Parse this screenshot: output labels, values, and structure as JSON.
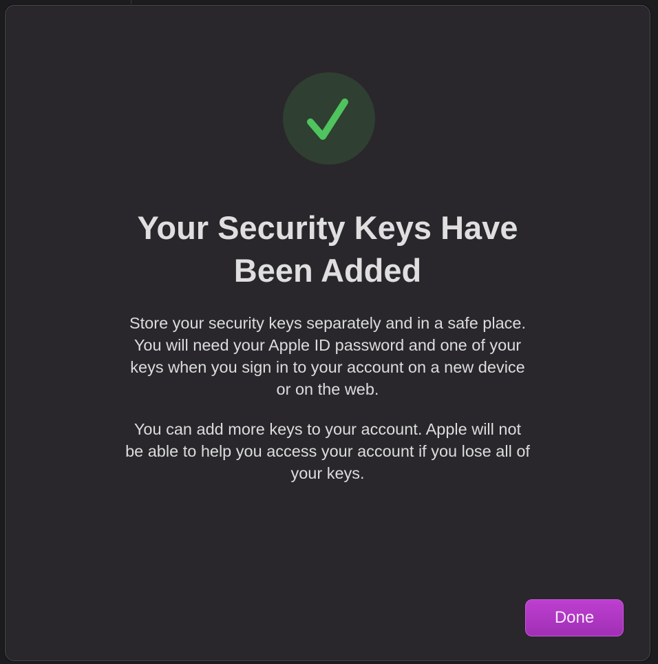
{
  "dialog": {
    "title_line1": "Your Security Keys Have",
    "title_line2": "Been Added",
    "paragraph1_lines": [
      "Store your security keys separately and in a safe place.",
      "You will need your Apple ID password and one of your",
      "keys when you sign in to your account on a new device",
      "or on the web."
    ],
    "paragraph2_lines": [
      "You can add more keys to your account. Apple will not",
      "be able to help you access your account if you lose all of",
      "your keys."
    ],
    "done_label": "Done",
    "icon": "checkmark-circle-icon"
  },
  "colors": {
    "accent": "#a934bb",
    "success_check": "#4fc35e",
    "success_circle": "#2f3f31",
    "sheet_background": "#29272b"
  }
}
